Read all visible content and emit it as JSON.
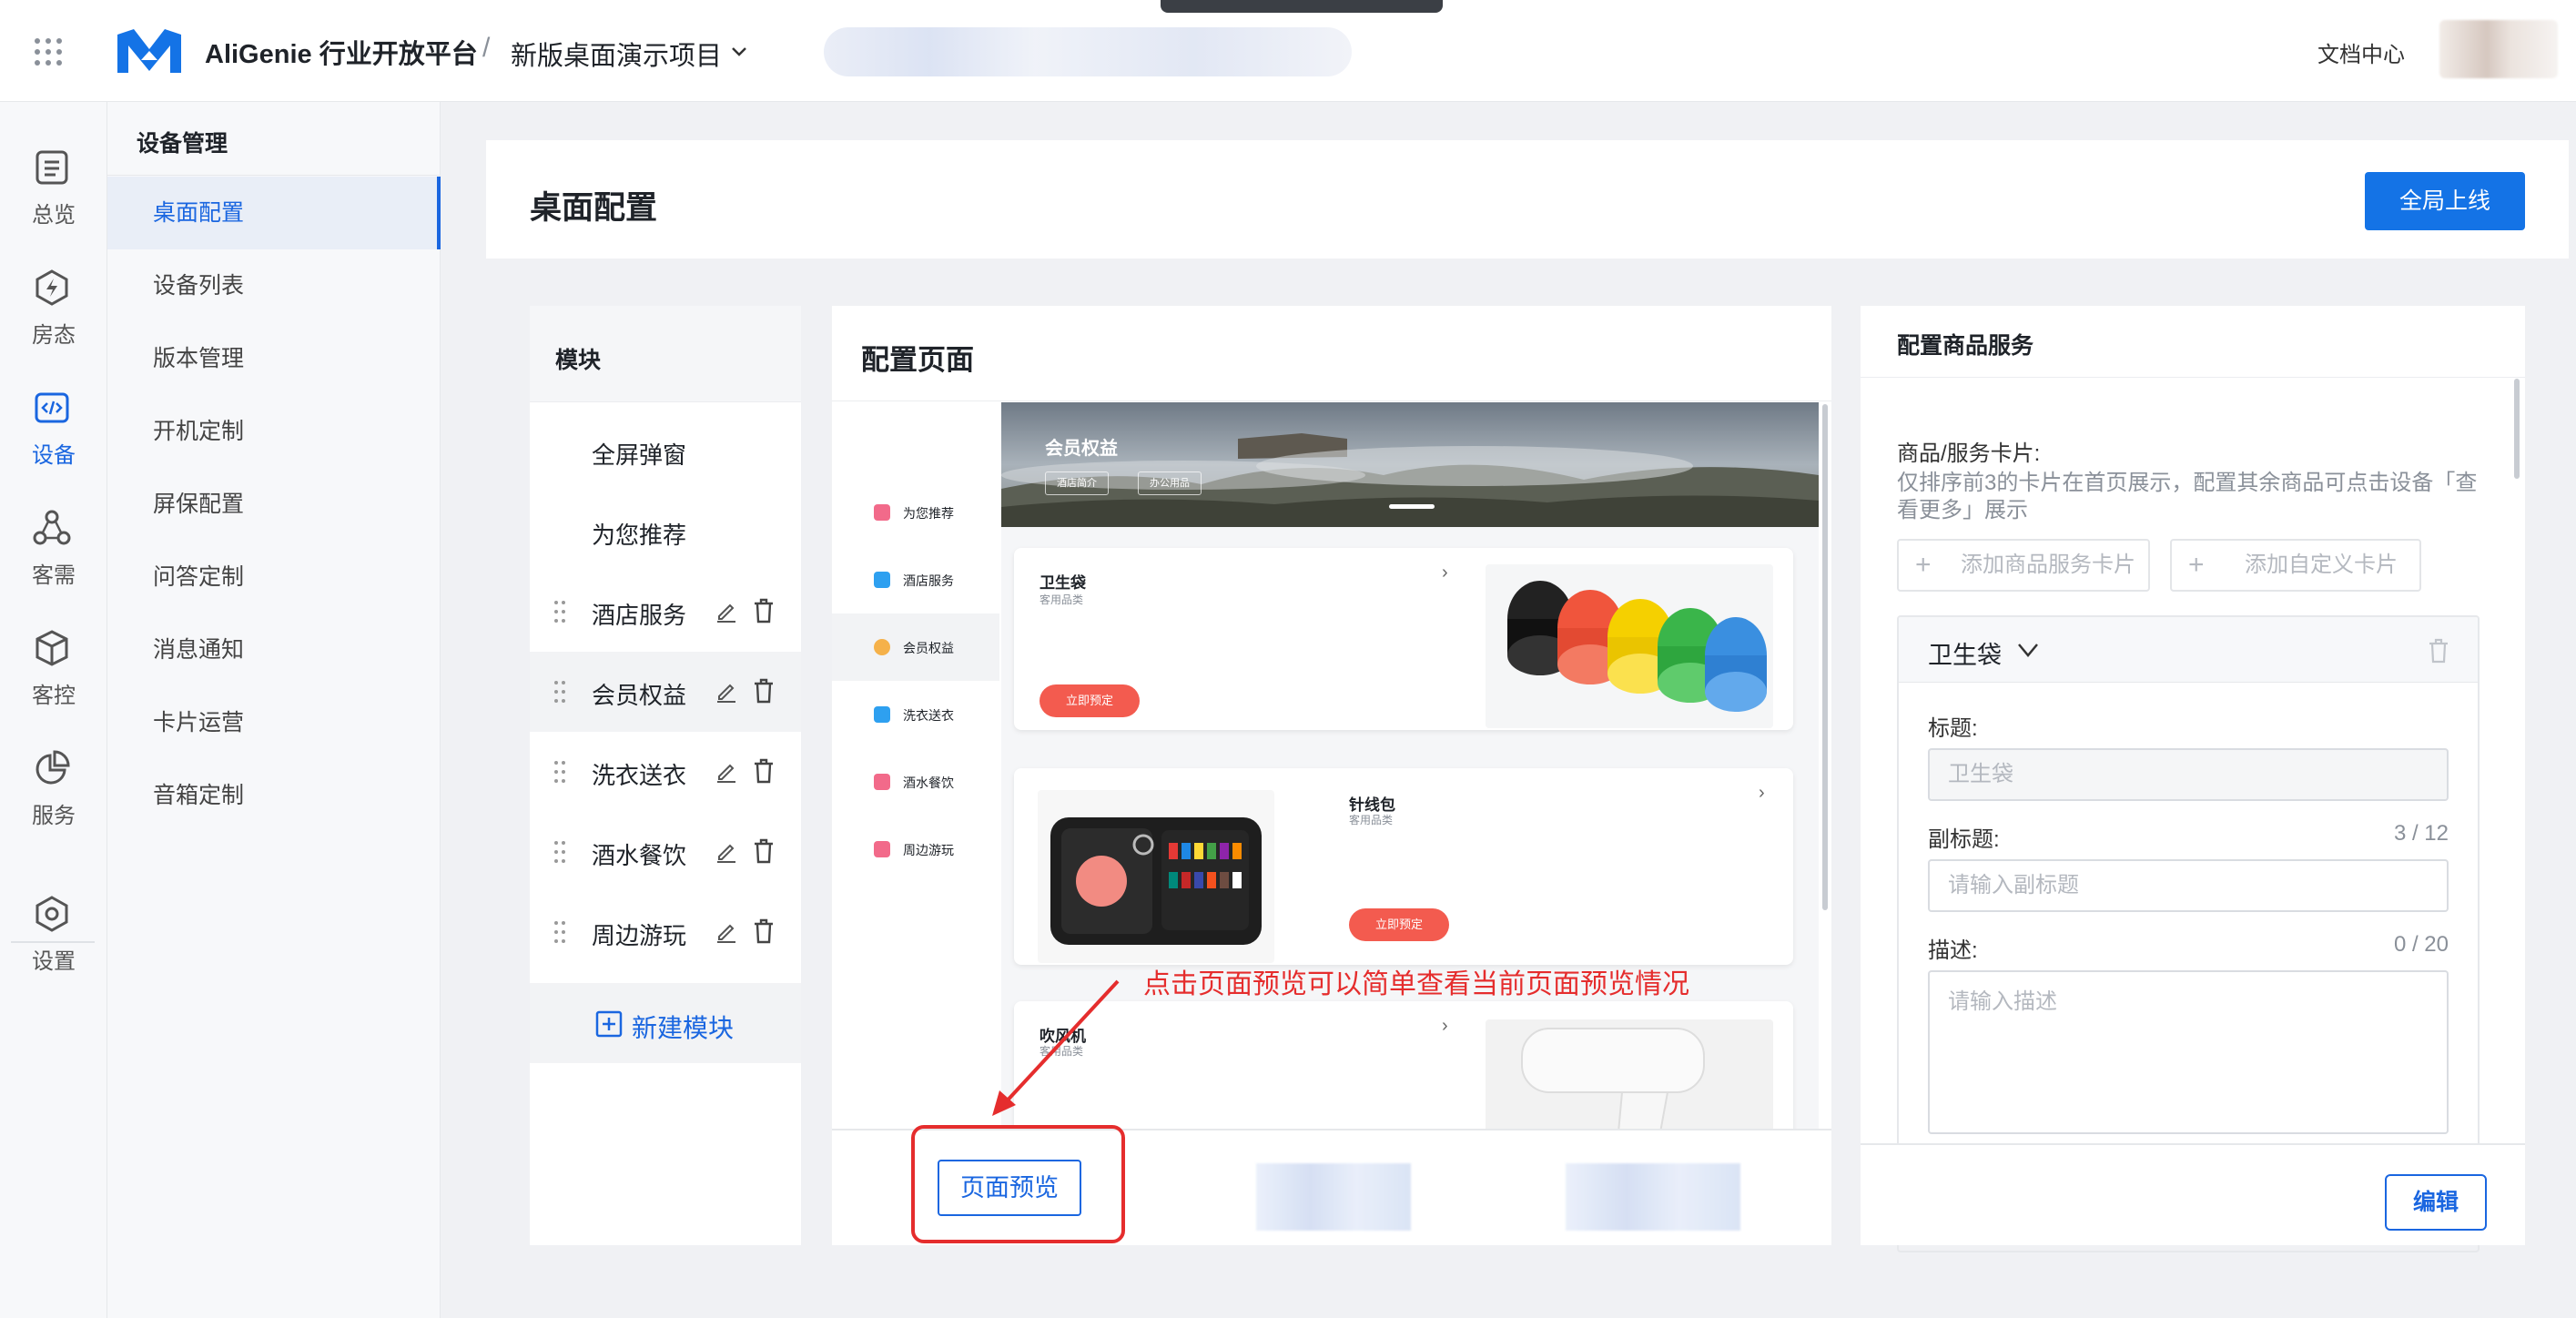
{
  "topbar": {
    "brand": "AliGenie 行业开放平台",
    "separator": "/",
    "project": "新版桌面演示项目",
    "doc_center": "文档中心"
  },
  "rail": {
    "items": [
      {
        "label": "总览",
        "icon": "list-icon"
      },
      {
        "label": "房态",
        "icon": "bolt-icon"
      },
      {
        "label": "设备",
        "icon": "code-icon"
      },
      {
        "label": "客需",
        "icon": "nodes-icon"
      },
      {
        "label": "客控",
        "icon": "cube-icon"
      },
      {
        "label": "服务",
        "icon": "pie-chart-icon"
      },
      {
        "label": "设置",
        "icon": "hexagon-settings-icon"
      }
    ],
    "active": "设备"
  },
  "subnav": {
    "title": "设备管理",
    "items": [
      "桌面配置",
      "设备列表",
      "版本管理",
      "开机定制",
      "屏保配置",
      "问答定制",
      "消息通知",
      "卡片运营",
      "音箱定制"
    ],
    "active": "桌面配置"
  },
  "header": {
    "title": "桌面配置",
    "publish_label": "全局上线"
  },
  "modules": {
    "title": "模块",
    "items": [
      "全屏弹窗",
      "为您推荐",
      "酒店服务",
      "会员权益",
      "洗衣送衣",
      "酒水餐饮",
      "周边游玩"
    ],
    "active": "会员权益",
    "new_label": "新建模块"
  },
  "config": {
    "title": "配置页面",
    "phone_tabs": [
      "为您推荐",
      "酒店服务",
      "会员权益",
      "洗衣送衣",
      "酒水餐饮",
      "周边游玩"
    ],
    "phone_active": "会员权益",
    "banner": {
      "title": "会员权益",
      "chips": [
        "酒店简介",
        "办公用品"
      ]
    },
    "cards": [
      {
        "title": "卫生袋",
        "subtitle": "客用品类",
        "button": "立即预定"
      },
      {
        "title": "针线包",
        "subtitle": "客用品类",
        "button": "立即预定"
      },
      {
        "title": "吹风机",
        "subtitle": "客用品类"
      }
    ],
    "preview_label": "页面预览",
    "hint": "点击页面预览可以简单查看当前页面预览情况"
  },
  "service": {
    "title": "配置商品服务",
    "cards_label": "商品/服务卡片:",
    "cards_desc": "仅排序前3的卡片在首页展示，配置其余商品可点击设备「查看更多」展示",
    "add_service_card": "添加商品服务卡片",
    "add_custom_card": "添加自定义卡片",
    "card": {
      "name": "卫生袋",
      "title_label": "标题:",
      "title_value": "卫生袋",
      "subtitle_label": "副标题:",
      "subtitle_count": "3 / 12",
      "subtitle_placeholder": "请输入副标题",
      "desc_label": "描述:",
      "desc_count": "0 / 20",
      "desc_placeholder": "请输入描述"
    },
    "edit_label": "编辑"
  },
  "colors": {
    "accent": "#1473e6",
    "hint_red": "#e52d2d",
    "book_button": "#f35b4f"
  }
}
